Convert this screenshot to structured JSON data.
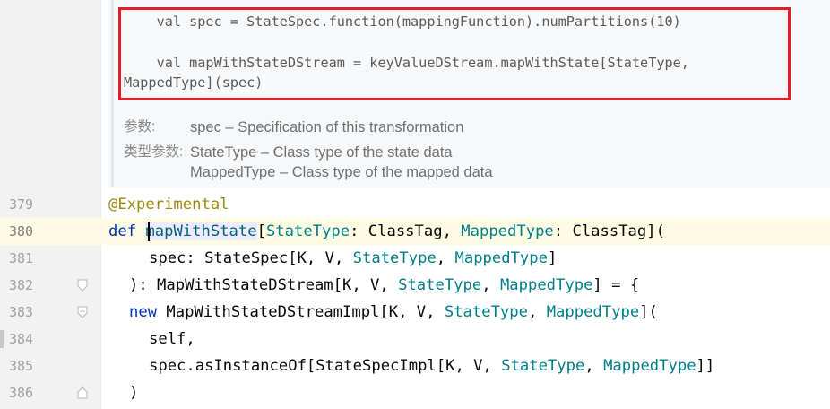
{
  "doc": {
    "code_lines": [
      "    val spec = StateSpec.function(mappingFunction).numPartitions(10)",
      "",
      "    val mapWithStateDStream = keyValueDStream.mapWithState[StateType,",
      "MappedType](spec)"
    ],
    "params_label": "参数:",
    "params_text": "spec – Specification of this transformation",
    "type_params_label": "类型参数:",
    "type_params_text_1": "StateType – Class type of the state data",
    "type_params_text_2": "MappedType – Class type of the mapped data"
  },
  "editor": {
    "lines": [
      {
        "number": "379",
        "indent": 0
      },
      {
        "number": "380",
        "indent": 0
      },
      {
        "number": "381",
        "indent": 1
      },
      {
        "number": "382",
        "indent": 0
      },
      {
        "number": "383",
        "indent": 0
      },
      {
        "number": "384",
        "indent": 1
      },
      {
        "number": "385",
        "indent": 1
      },
      {
        "number": "386",
        "indent": 0
      }
    ],
    "current_line": "380",
    "tokens": {
      "l379_annotation": "@Experimental",
      "l380_def": "def ",
      "l380_name": "mapWithState",
      "l380_open": "[",
      "l380_st": "StateType",
      "l380_c1": ": ClassTag, ",
      "l380_mt": "MappedType",
      "l380_c2": ": ClassTag](",
      "l381_a": "spec: StateSpec[K, V, ",
      "l381_st": "StateType",
      "l381_b": ", ",
      "l381_mt": "MappedType",
      "l381_c": "]",
      "l382_a": "): MapWithStateDStream[K, V, ",
      "l382_st": "StateType",
      "l382_b": ", ",
      "l382_mt": "MappedType",
      "l382_c": "] = {",
      "l383_new": "new ",
      "l383_a": "MapWithStateDStreamImpl[K, V, ",
      "l383_st": "StateType",
      "l383_b": ", ",
      "l383_mt": "MappedType",
      "l383_c": "](",
      "l384_a": "self,",
      "l385_a": "spec.asInstanceOf[StateSpecImpl[K, V, ",
      "l385_st": "StateType",
      "l385_b": ", ",
      "l385_mt": "MappedType",
      "l385_c": "]]",
      "l386_a": ")"
    }
  },
  "colors": {
    "keyword": "#0033b3",
    "annotation": "#9e880d",
    "type_param": "#007e8a",
    "function_name": "#00627a",
    "highlight_box": "#e31e24"
  }
}
